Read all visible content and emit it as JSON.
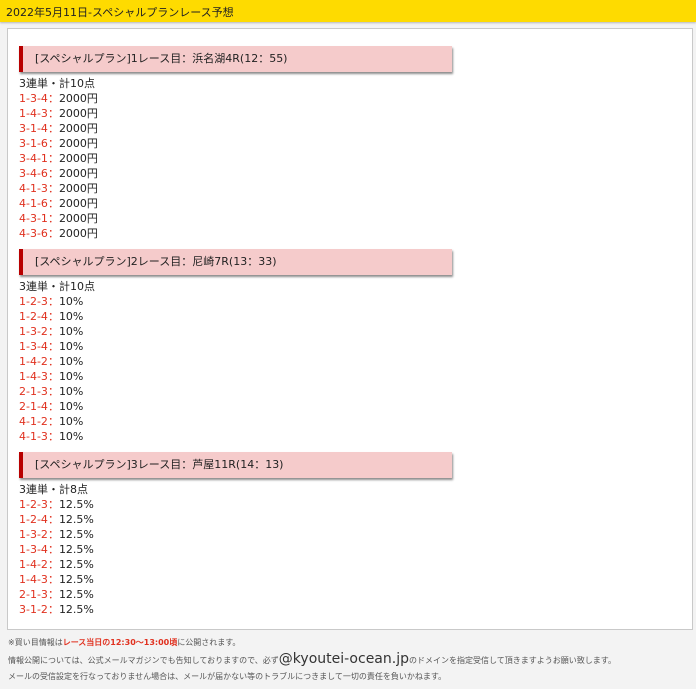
{
  "header": {
    "title": "2022年5月11日-スペシャルプランレース予想"
  },
  "sections": [
    {
      "title": "[スペシャルプラン]1レース目：浜名湖4R(12：55)",
      "summary": "3連単・計10点",
      "bets": [
        {
          "combo": "1-3-4",
          "amount": "2000円"
        },
        {
          "combo": "1-4-3",
          "amount": "2000円"
        },
        {
          "combo": "3-1-4",
          "amount": "2000円"
        },
        {
          "combo": "3-1-6",
          "amount": "2000円"
        },
        {
          "combo": "3-4-1",
          "amount": "2000円"
        },
        {
          "combo": "3-4-6",
          "amount": "2000円"
        },
        {
          "combo": "4-1-3",
          "amount": "2000円"
        },
        {
          "combo": "4-1-6",
          "amount": "2000円"
        },
        {
          "combo": "4-3-1",
          "amount": "2000円"
        },
        {
          "combo": "4-3-6",
          "amount": "2000円"
        }
      ]
    },
    {
      "title": "[スペシャルプラン]2レース目：尼崎7R(13：33)",
      "summary": "3連単・計10点",
      "bets": [
        {
          "combo": "1-2-3",
          "amount": "10%"
        },
        {
          "combo": "1-2-4",
          "amount": "10%"
        },
        {
          "combo": "1-3-2",
          "amount": "10%"
        },
        {
          "combo": "1-3-4",
          "amount": "10%"
        },
        {
          "combo": "1-4-2",
          "amount": "10%"
        },
        {
          "combo": "1-4-3",
          "amount": "10%"
        },
        {
          "combo": "2-1-3",
          "amount": "10%"
        },
        {
          "combo": "2-1-4",
          "amount": "10%"
        },
        {
          "combo": "4-1-2",
          "amount": "10%"
        },
        {
          "combo": "4-1-3",
          "amount": "10%"
        }
      ]
    },
    {
      "title": "[スペシャルプラン]3レース目：芦屋11R(14：13)",
      "summary": "3連単・計8点",
      "bets": [
        {
          "combo": "1-2-3",
          "amount": "12.5%"
        },
        {
          "combo": "1-2-4",
          "amount": "12.5%"
        },
        {
          "combo": "1-3-2",
          "amount": "12.5%"
        },
        {
          "combo": "1-3-4",
          "amount": "12.5%"
        },
        {
          "combo": "1-4-2",
          "amount": "12.5%"
        },
        {
          "combo": "1-4-3",
          "amount": "12.5%"
        },
        {
          "combo": "2-1-3",
          "amount": "12.5%"
        },
        {
          "combo": "3-1-2",
          "amount": "12.5%"
        }
      ]
    }
  ],
  "bet_separator": "：",
  "footer": {
    "line1_prefix": "※買い目情報は",
    "line1_highlight": "レース当日の12:30〜13:00頃",
    "line1_suffix": "に公開されます。",
    "line2_prefix": "情報公開については、公式メールマガジンでも告知しておりますので、必ず",
    "line2_domain": "@kyoutei-ocean.jp",
    "line2_suffix": "のドメインを指定受信して頂きますようお願い致します。",
    "line3": "メールの受信設定を行なっておりません場合は、メールが届かない等のトラブルにつきまして一切の責任を負いかねます。"
  }
}
